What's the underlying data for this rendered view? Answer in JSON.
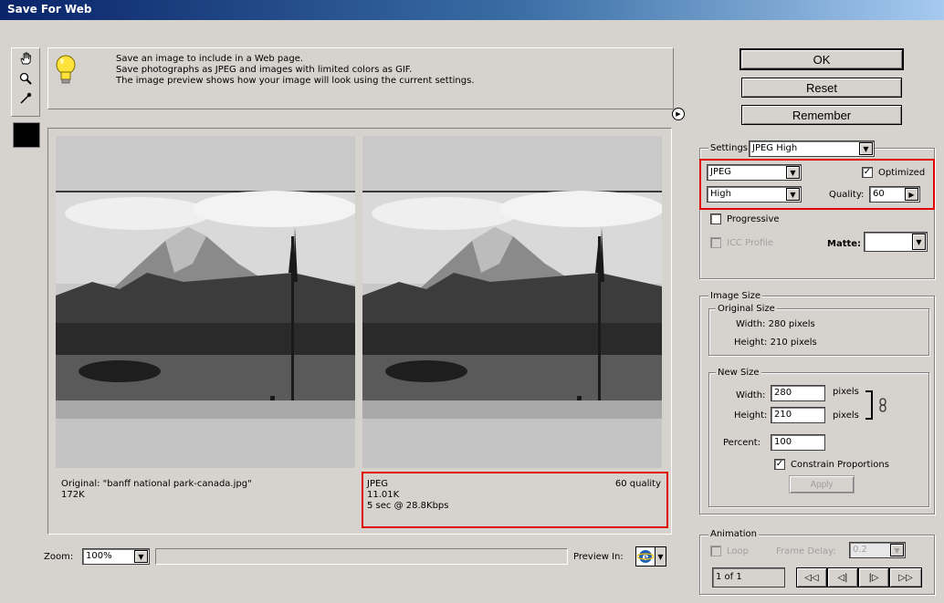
{
  "window": {
    "title": "Save For Web"
  },
  "help": {
    "line1": "Save an image to include in a Web page.",
    "line2": "Save photographs as JPEG and images with limited colors as GIF.",
    "line3": "The image preview shows how your image will look using the current settings."
  },
  "buttons": {
    "ok": "OK",
    "reset": "Reset",
    "remember": "Remember",
    "apply": "Apply"
  },
  "settings": {
    "label": "Settings:",
    "preset": "JPEG High",
    "format": "JPEG",
    "quality_preset": "High",
    "optimized_label": "Optimized",
    "optimized": true,
    "quality_label": "Quality:",
    "quality_value": "60",
    "progressive_label": "Progressive",
    "icc_label": "ICC Profile",
    "matte_label": "Matte:"
  },
  "image_size": {
    "title": "Image Size",
    "original_title": "Original Size",
    "orig_width": "Width: 280 pixels",
    "orig_height": "Height: 210 pixels",
    "new_title": "New Size",
    "width_label": "Width:",
    "width_value": "280",
    "height_label": "Height:",
    "height_value": "210",
    "units": "pixels",
    "percent_label": "Percent:",
    "percent_value": "100",
    "constrain_label": "Constrain Proportions"
  },
  "animation": {
    "title": "Animation",
    "loop_label": "Loop",
    "frame_delay_label": "Frame Delay:",
    "frame_delay_value": "0.2",
    "frame_counter": "1 of 1",
    "first": "◁◁",
    "prev": "◁|",
    "next": "|▷",
    "last": "▷▷"
  },
  "original_info": {
    "name": "Original: \"banff national park-canada.jpg\"",
    "size": "172K"
  },
  "optimized_info": {
    "format": "JPEG",
    "quality": "60 quality",
    "size": "11.01K",
    "download": "5 sec @ 28.8Kbps"
  },
  "bottom": {
    "zoom_label": "Zoom:",
    "zoom_value": "100%",
    "preview_label": "Preview In:"
  },
  "colors": {
    "highlight": "#e00000",
    "title_bar": "#0a246a"
  }
}
